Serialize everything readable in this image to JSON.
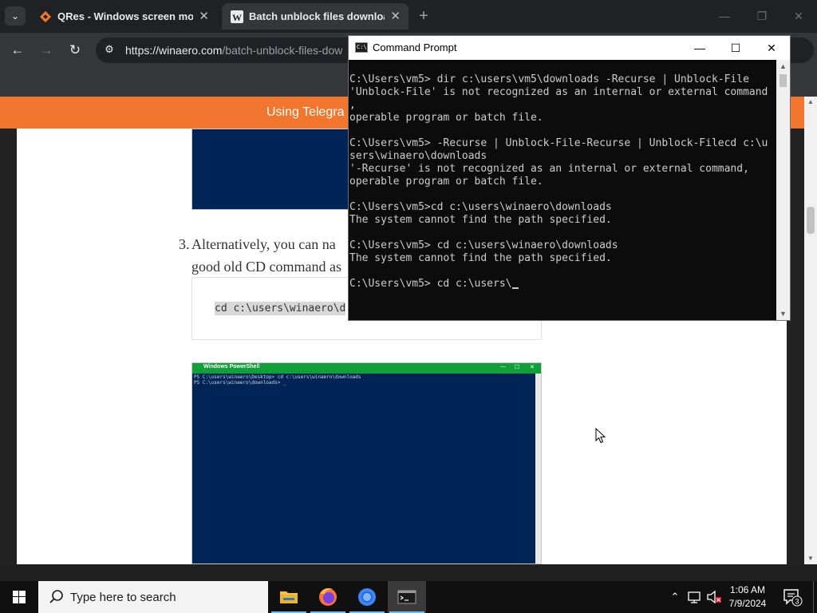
{
  "browser": {
    "tabs": [
      {
        "title": "QRes - Windows screen mode",
        "close": "✕"
      },
      {
        "title": "Batch unblock files downloade",
        "close": "✕"
      }
    ],
    "tab_list_glyph": "⌄",
    "new_tab_glyph": "+",
    "window_controls": {
      "minimize": "—",
      "restore": "❐",
      "close": "✕"
    },
    "nav": {
      "back": "←",
      "forward": "→",
      "reload": "↻"
    },
    "site_info_glyph": "⚙",
    "url_base": "https://winaero.com",
    "url_rest": "/batch-unblock-files-dow",
    "icons": {
      "tab1": "qres-favicon-icon",
      "tab2": "winaero-favicon-icon"
    }
  },
  "page": {
    "banner_text": "Using Telegra",
    "step_number": "3.",
    "step_line1": "Alternatively, you can na",
    "step_line2": "good old CD command as",
    "code_text": "cd c:\\users\\winaero\\d",
    "powershell_title": "Windows PowerShell",
    "powershell_lines": [
      "PS C:\\users\\winaero\\Desktop> cd c:\\users\\winaero\\downloads",
      "PS C:\\users\\winaero\\downloads> _"
    ],
    "scroll_up": "▲",
    "scroll_down": "▼"
  },
  "cmd": {
    "title": "Command Prompt",
    "icon_text": "C:\\",
    "controls": {
      "minimize": "—",
      "maximize": "☐",
      "close": "✕"
    },
    "lines": [
      "C:\\Users\\vm5> dir c:\\users\\vm5\\downloads -Recurse | Unblock-File",
      "'Unblock-File' is not recognized as an internal or external command",
      ",",
      "operable program or batch file.",
      "",
      "C:\\Users\\vm5> -Recurse | Unblock-File-Recurse | Unblock-Filecd c:\\u",
      "sers\\winaero\\downloads",
      "'-Recurse' is not recognized as an internal or external command,",
      "operable program or batch file.",
      "",
      "C:\\Users\\vm5>cd c:\\users\\winaero\\downloads",
      "The system cannot find the path specified.",
      "",
      "C:\\Users\\vm5> cd c:\\users\\winaero\\downloads",
      "The system cannot find the path specified.",
      "",
      "C:\\Users\\vm5> cd c:\\users\\"
    ],
    "scroll_up": "▲",
    "scroll_down": "▼"
  },
  "taskbar": {
    "search_placeholder": "Type here to search",
    "apps": [
      "file-explorer-icon",
      "firefox-icon",
      "chrome-icon",
      "terminal-icon"
    ],
    "time": "1:06 AM",
    "date": "7/9/2024",
    "tray_chevron": "⌃",
    "notification_count": "3"
  },
  "colors": {
    "banner": "#f2762e",
    "powershell_bg": "#012456",
    "powershell_title": "#119f3a",
    "taskbar": "#101010"
  }
}
